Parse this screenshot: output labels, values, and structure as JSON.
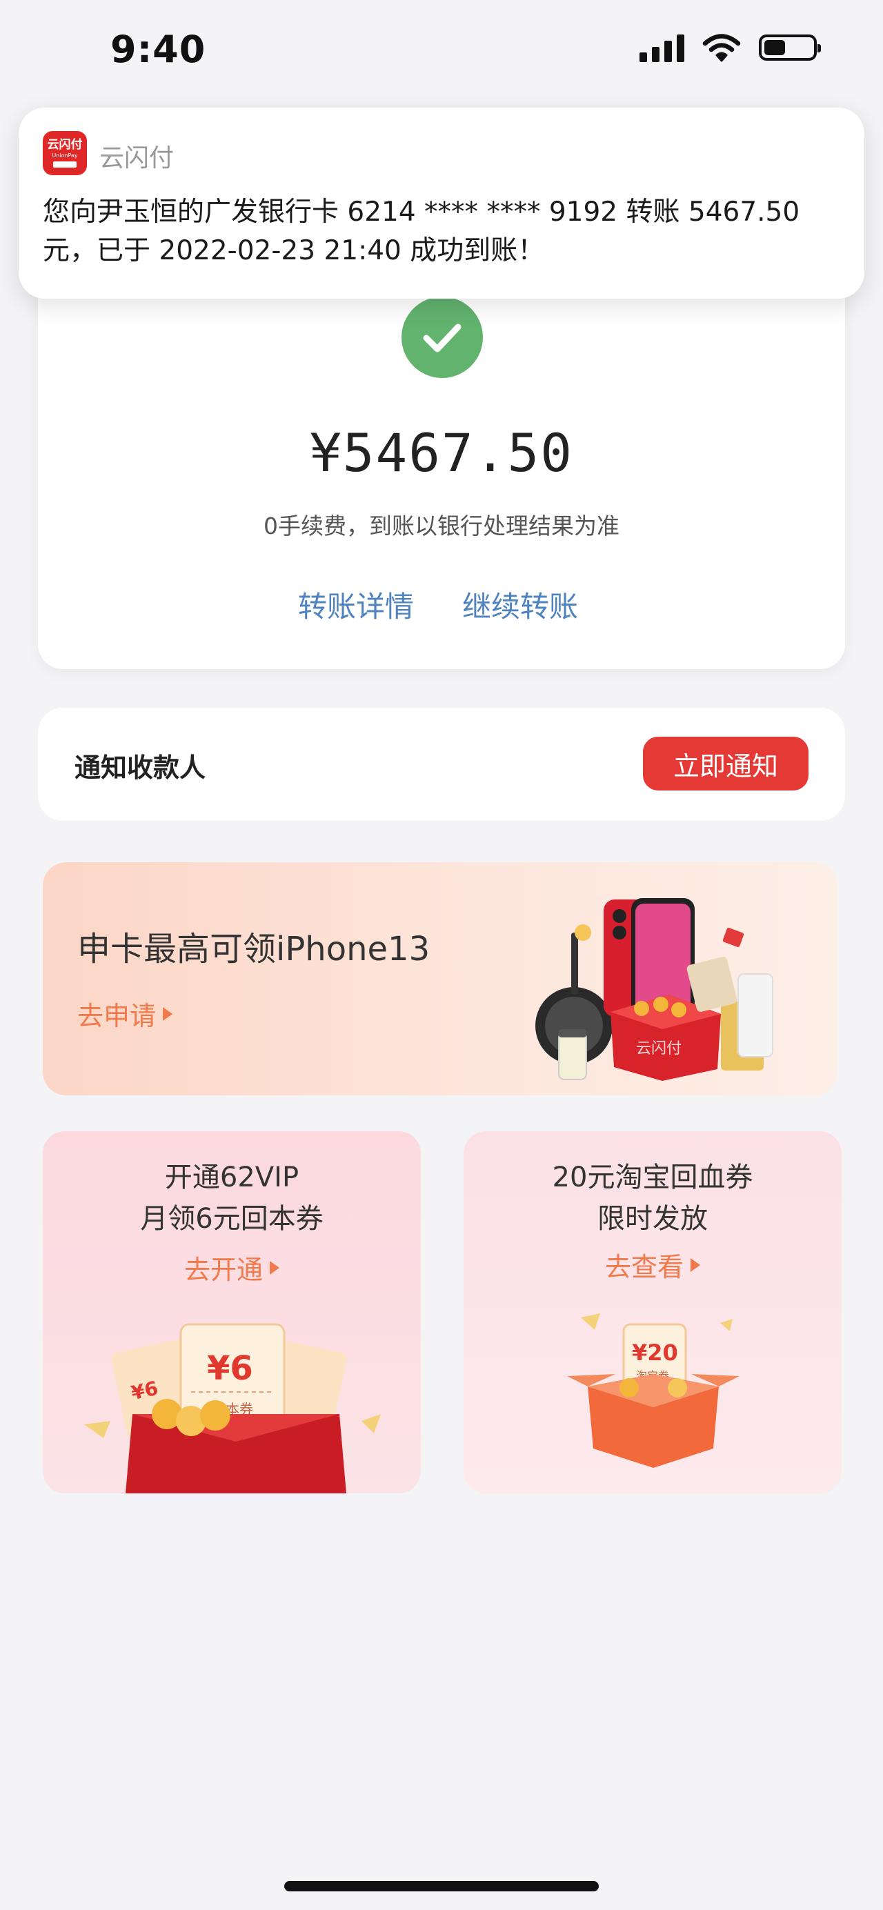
{
  "status_bar": {
    "time": "9:40"
  },
  "notification": {
    "app_name": "云闪付",
    "app_icon_text": "云闪付",
    "app_icon_sub": "UnionPay",
    "message": "您向尹玉恒的广发银行卡 6214 **** **** 9192 转账 5467.50 元，已于 2022-02-23 21:40 成功到账！"
  },
  "result": {
    "amount": "¥5467.50",
    "fee_note": "0手续费，到账以银行处理结果为准",
    "detail_link": "转账详情",
    "continue_link": "继续转账",
    "success_color": "#62b36e"
  },
  "notify_payee": {
    "label": "通知收款人",
    "button": "立即通知",
    "button_color": "#e53935"
  },
  "promo_banner": {
    "title": "申卡最高可领iPhone13",
    "cta": "去申请",
    "gift_box_label": "云闪付"
  },
  "vip_card": {
    "line1": "开通62VIP",
    "line2": "月领6元回本券",
    "cta": "去开通",
    "coupon_value": "¥6",
    "coupon_side": "¥6",
    "coupon_label": "回本券"
  },
  "taobao_card": {
    "line1": "20元淘宝回血券",
    "line2": "限时发放",
    "cta": "去查看",
    "coupon_value": "¥20",
    "coupon_label": "淘宝券"
  },
  "accent_color": "#f07a4c"
}
